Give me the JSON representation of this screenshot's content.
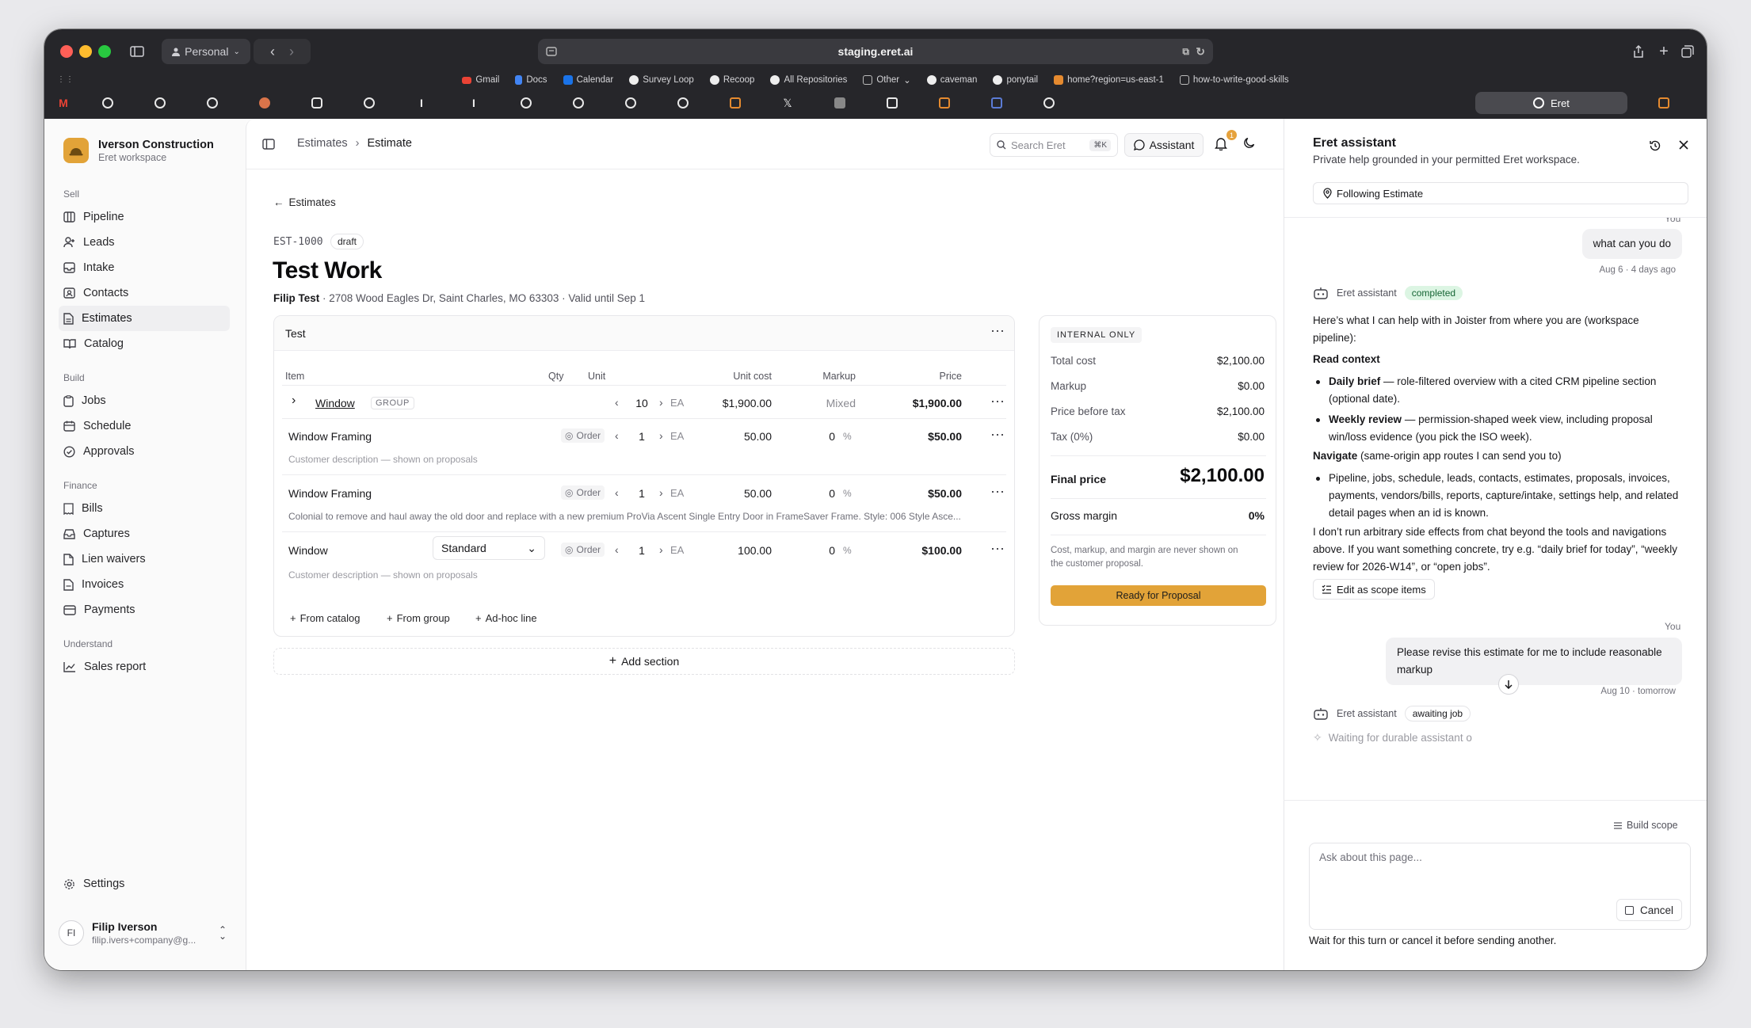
{
  "browser": {
    "profile": "Personal",
    "url": "staging.eret.ai",
    "bookmarks": [
      "Gmail",
      "Docs",
      "Calendar",
      "Survey Loop",
      "Recoop",
      "All Repositories",
      "Other",
      "caveman",
      "ponytail",
      "home?region=us-east-1",
      "how-to-write-good-skills"
    ],
    "active_tab": "Eret"
  },
  "sidebar": {
    "org_name": "Iverson Construction",
    "org_sub": "Eret workspace",
    "sections": {
      "sell": "Sell",
      "build": "Build",
      "finance": "Finance",
      "understand": "Understand"
    },
    "items": {
      "pipeline": "Pipeline",
      "leads": "Leads",
      "intake": "Intake",
      "contacts": "Contacts",
      "estimates": "Estimates",
      "catalog": "Catalog",
      "jobs": "Jobs",
      "schedule": "Schedule",
      "approvals": "Approvals",
      "bills": "Bills",
      "captures": "Captures",
      "lien_waivers": "Lien waivers",
      "invoices": "Invoices",
      "payments": "Payments",
      "sales_report": "Sales report",
      "settings": "Settings"
    },
    "user": {
      "initials": "FI",
      "name": "Filip Iverson",
      "email": "filip.ivers+company@g..."
    }
  },
  "header": {
    "crumb_parent": "Estimates",
    "crumb_current": "Estimate",
    "search_placeholder": "Search Eret",
    "search_shortcut": "⌘K",
    "assistant_label": "Assistant",
    "notification_count": "1"
  },
  "estimate": {
    "back_label": "Estimates",
    "code": "EST-1000",
    "status": "draft",
    "title": "Test Work",
    "client": "Filip Test",
    "meta": " · 2708 Wood Eagles Dr, Saint Charles, MO 63303 · Valid until Sep 1",
    "section": {
      "name": "Test",
      "columns": {
        "item": "Item",
        "qty": "Qty",
        "unit": "Unit",
        "unit_cost": "Unit cost",
        "markup": "Markup",
        "price": "Price"
      },
      "rows": [
        {
          "name": "Window",
          "tag": "GROUP",
          "qty": "10",
          "unit": "EA",
          "unit_cost": "$1,900.00",
          "markup": "Mixed",
          "price": "$1,900.00"
        },
        {
          "name": "Window Framing",
          "order": "Order",
          "qty": "1",
          "unit": "EA",
          "unit_cost": "50.00",
          "markup": "0",
          "markup_unit": "%",
          "price": "$50.00",
          "description": "Customer description — shown on proposals"
        },
        {
          "name": "Window Framing",
          "order": "Order",
          "qty": "1",
          "unit": "EA",
          "unit_cost": "50.00",
          "markup": "0",
          "markup_unit": "%",
          "price": "$50.00",
          "description": "Colonial to remove and haul away the old door and replace with a new premium ProVia Ascent Single Entry Door in FrameSaver Frame. Style: 006 Style Asce..."
        },
        {
          "name": "Window",
          "variant": "Standard",
          "order": "Order",
          "qty": "1",
          "unit": "EA",
          "unit_cost": "100.00",
          "markup": "0",
          "markup_unit": "%",
          "price": "$100.00",
          "description": "Customer description — shown on proposals"
        }
      ],
      "add_catalog": "From catalog",
      "add_group": "From group",
      "add_adhoc": "Ad-hoc line"
    },
    "add_section": "Add section",
    "summary": {
      "tag": "INTERNAL ONLY",
      "total_cost_label": "Total cost",
      "total_cost": "$2,100.00",
      "markup_label": "Markup",
      "markup": "$0.00",
      "price_before_tax_label": "Price before tax",
      "price_before_tax": "$2,100.00",
      "tax_label": "Tax (0%)",
      "tax": "$0.00",
      "final_label": "Final price",
      "final": "$2,100.00",
      "margin_label": "Gross margin",
      "margin": "0%",
      "note": "Cost, markup, and margin are never shown on the customer proposal.",
      "proposal_button": "Ready for Proposal"
    }
  },
  "assistant": {
    "title": "Eret assistant",
    "subtitle": "Private help grounded in your permitted Eret workspace.",
    "following": "Following Estimate",
    "you_label": "You",
    "bot_label": "Eret assistant",
    "msg1": "what can you do",
    "msg1_time": "Aug 6 · 4 days ago",
    "status_completed": "completed",
    "intro": "Here’s what I can help with in Joister from where you are (workspace pipeline):",
    "read_context": "Read context",
    "b1_title": "Daily brief",
    "b1_text": " — role-filtered overview with a cited CRM pipeline section (optional date).",
    "b2_title": "Weekly review",
    "b2_text": " — permission-shaped week view, including proposal win/loss evidence (you pick the ISO week).",
    "navigate_title": "Navigate",
    "navigate_text": " (same-origin app routes I can send you to)",
    "b3_text": "Pipeline, jobs, schedule, leads, contacts, estimates, proposals, invoices, payments, vendors/bills, reports, capture/intake, settings help, and related detail pages when an id is known.",
    "closing": "I don’t run arbitrary side effects from chat beyond the tools and navigations above. If you want something concrete, try e.g. “daily brief for today”, “weekly review for 2026-W14”, or “open jobs”.",
    "scope_button": "Edit as scope items",
    "msg2": "Please revise this estimate for me to include reasonable markup",
    "msg2_time": "Aug 10 · tomorrow",
    "status_awaiting": "awaiting job",
    "waiting": "Waiting for durable assistant o",
    "build_scope": "Build scope",
    "composer_placeholder": "Ask about this page...",
    "cancel": "Cancel",
    "wait_note": "Wait for this turn or cancel it before sending another."
  },
  "colors": {
    "accent": "#e2a338",
    "chrome": "#26262a",
    "completed_bg": "#dcf5e3"
  }
}
